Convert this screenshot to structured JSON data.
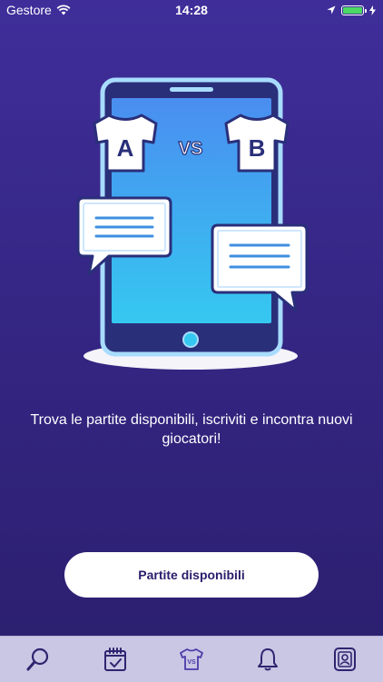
{
  "status_bar": {
    "carrier": "Gestore",
    "time": "14:28",
    "battery_color": "#4cd964"
  },
  "illustration": {
    "team_a_letter": "A",
    "team_b_letter": "B",
    "versus_label": "VS"
  },
  "onboarding": {
    "caption": "Trova le partite disponibili, iscriviti e incontra nuovi giocatori!",
    "cta_label": "Partite disponibili"
  },
  "tab_bar": {
    "tabs": [
      {
        "icon": "search-icon",
        "active": false
      },
      {
        "icon": "calendar-check-icon",
        "active": false
      },
      {
        "icon": "shirt-vs-icon",
        "active": true
      },
      {
        "icon": "bell-icon",
        "active": false
      },
      {
        "icon": "profile-card-icon",
        "active": false
      }
    ],
    "colors": {
      "active": "#4a3ca8",
      "inactive": "#2e2570"
    }
  },
  "colors": {
    "background_top": "#3f2e9a",
    "background_bottom": "#2b1f6e",
    "phone_screen_top": "#4a8df0",
    "phone_screen_bottom": "#35c8f0",
    "phone_frame": "#9fd8ff",
    "button_text": "#2a1d6b"
  }
}
